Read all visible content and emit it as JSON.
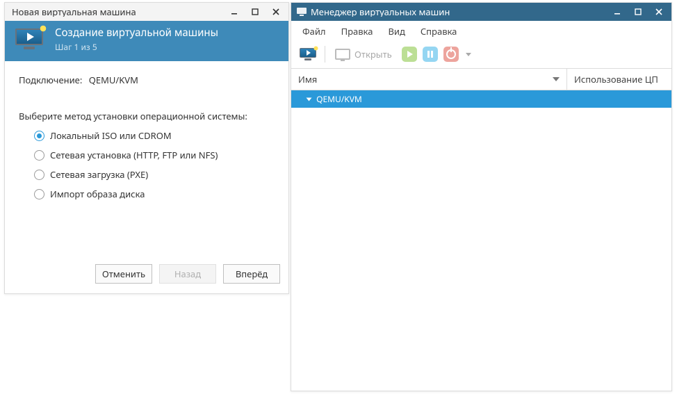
{
  "wizard": {
    "window_title": "Новая виртуальная машина",
    "heading": "Создание виртуальной машины",
    "step_text": "Шаг 1 из 5",
    "connection_label": "Подключение:",
    "connection_value": "QEMU/KVM",
    "prompt": "Выберите метод установки операционной системы:",
    "options": [
      {
        "label": "Локальный ISO или CDROM",
        "checked": true
      },
      {
        "label": "Сетевая установка (HTTP, FTP или NFS)",
        "checked": false
      },
      {
        "label": "Сетевая загрузка (PXE)",
        "checked": false
      },
      {
        "label": "Импорт образа диска",
        "checked": false
      }
    ],
    "buttons": {
      "cancel": "Отменить",
      "back": "Назад",
      "forward": "Вперёд"
    }
  },
  "manager": {
    "window_title": "Менеджер виртуальных машин",
    "menu": {
      "file": "Файл",
      "edit": "Правка",
      "view": "Вид",
      "help": "Справка"
    },
    "toolbar": {
      "open_label": "Открыть"
    },
    "columns": {
      "name": "Имя",
      "cpu": "Использование ЦП"
    },
    "rows": [
      {
        "label": "QEMU/KVM"
      }
    ]
  }
}
